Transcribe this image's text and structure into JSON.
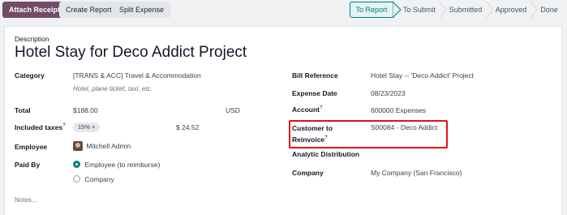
{
  "toolbar": {
    "attach_receipt": "Attach Receipt",
    "create_report": "Create Report",
    "split_expense": "Split Expense"
  },
  "statusbar": {
    "stages": [
      "To Report",
      "To Submit",
      "Submitted",
      "Approved",
      "Done"
    ],
    "active_index": 0
  },
  "form": {
    "description_label": "Description",
    "title": "Hotel Stay for Deco Addict Project",
    "category_label": "Category",
    "category_value": "[TRANS & ACC] Travel & Accommodation",
    "category_hint": "Hotel, plane ticket, taxi, etc.",
    "total_label": "Total",
    "total_value": "$188.00",
    "currency": "USD",
    "included_taxes_label": "Included taxes",
    "tax_tag": "15% ×",
    "tax_amount": "$ 24.52",
    "employee_label": "Employee",
    "employee_value": "Mitchell Admin",
    "paid_by_label": "Paid By",
    "paid_by_options": [
      "Employee (to reimburse)",
      "Company"
    ],
    "paid_by_selected": 0,
    "notes_placeholder": "Notes...",
    "bill_reference_label": "Bill Reference",
    "bill_reference_value": "Hotel Stay -- 'Deco Addict' Project",
    "expense_date_label": "Expense Date",
    "expense_date_value": "08/23/2023",
    "account_label": "Account",
    "account_value": "600000 Expenses",
    "customer_reinvoice_label_line1": "Customer to",
    "customer_reinvoice_label_line2": "Reinvoice",
    "customer_reinvoice_value": "S00084 - Deco Addict",
    "analytic_label": "Analytic Distribution",
    "company_label": "Company",
    "company_value": "My Company (San Francisco)",
    "help_mark": "?"
  },
  "colors": {
    "primary": "#714b67",
    "accent": "#017e84",
    "highlight": "#e30f16"
  }
}
